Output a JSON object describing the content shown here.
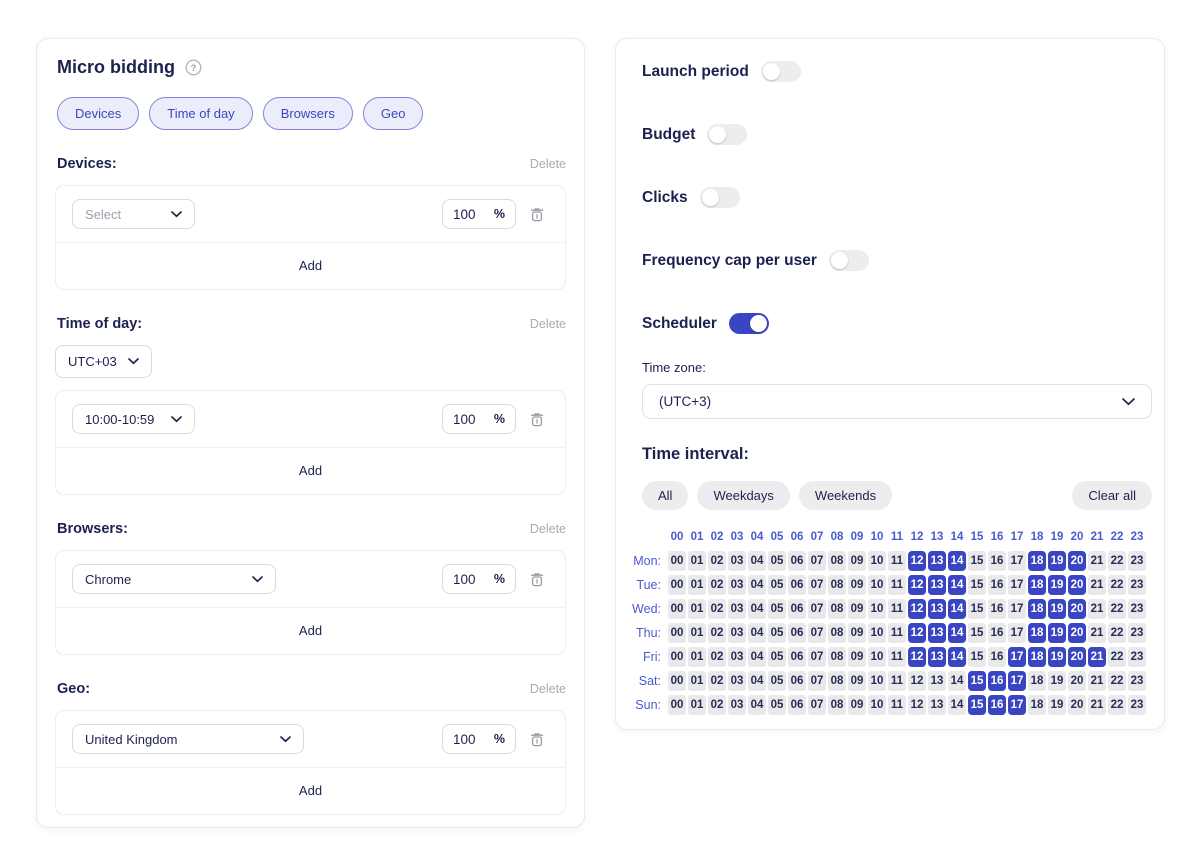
{
  "colors": {
    "accent_blue": "#3a45c3",
    "grid_label_blue": "#4a5ace",
    "navy_text": "#1c2150",
    "cell_gray": "#e9e9ec",
    "pill_bg": "#ebedfa",
    "pill_border": "#7d86da"
  },
  "left_panel": {
    "title": "Micro bidding",
    "help_icon": "question-circle",
    "pills": [
      "Devices",
      "Time of day",
      "Browsers",
      "Geo"
    ],
    "sections": [
      {
        "label": "Devices:",
        "delete_label": "Delete",
        "select_value": "Select",
        "percent": "100",
        "percent_unit": "%",
        "add_label": "Add"
      },
      {
        "label": "Time of day:",
        "delete_label": "Delete",
        "utc_select": "UTC+03",
        "select_value": "10:00-10:59",
        "percent": "100",
        "percent_unit": "%",
        "add_label": "Add"
      },
      {
        "label": "Browsers:",
        "delete_label": "Delete",
        "select_value": "Chrome",
        "percent": "100",
        "percent_unit": "%",
        "add_label": "Add"
      },
      {
        "label": "Geo:",
        "delete_label": "Delete",
        "select_value": "United Kingdom",
        "percent": "100",
        "percent_unit": "%",
        "add_label": "Add"
      }
    ]
  },
  "right_panel": {
    "toggles": [
      {
        "label": "Launch period",
        "on": false
      },
      {
        "label": "Budget",
        "on": false
      },
      {
        "label": "Clicks",
        "on": false
      },
      {
        "label": "Frequency cap per user",
        "on": false
      },
      {
        "label": "Scheduler",
        "on": true
      }
    ],
    "time_zone": {
      "label": "Time zone:",
      "value": "(UTC+3)"
    },
    "time_interval": {
      "label": "Time interval:",
      "buttons": [
        "All",
        "Weekdays",
        "Weekends"
      ],
      "clear_label": "Clear all"
    },
    "schedule": {
      "hours": [
        "00",
        "01",
        "02",
        "03",
        "04",
        "05",
        "06",
        "07",
        "08",
        "09",
        "10",
        "11",
        "12",
        "13",
        "14",
        "15",
        "16",
        "17",
        "18",
        "19",
        "20",
        "21",
        "22",
        "23"
      ],
      "days": [
        {
          "label": "Mon:",
          "selected": [
            12,
            13,
            14,
            18,
            19,
            20
          ]
        },
        {
          "label": "Tue:",
          "selected": [
            12,
            13,
            14,
            18,
            19,
            20
          ]
        },
        {
          "label": "Wed:",
          "selected": [
            12,
            13,
            14,
            18,
            19,
            20
          ]
        },
        {
          "label": "Thu:",
          "selected": [
            12,
            13,
            14,
            18,
            19,
            20
          ]
        },
        {
          "label": "Fri:",
          "selected": [
            12,
            13,
            14,
            17,
            18,
            19,
            20,
            21
          ]
        },
        {
          "label": "Sat:",
          "selected": [
            15,
            16,
            17
          ]
        },
        {
          "label": "Sun:",
          "selected": [
            15,
            16,
            17
          ]
        }
      ]
    }
  }
}
